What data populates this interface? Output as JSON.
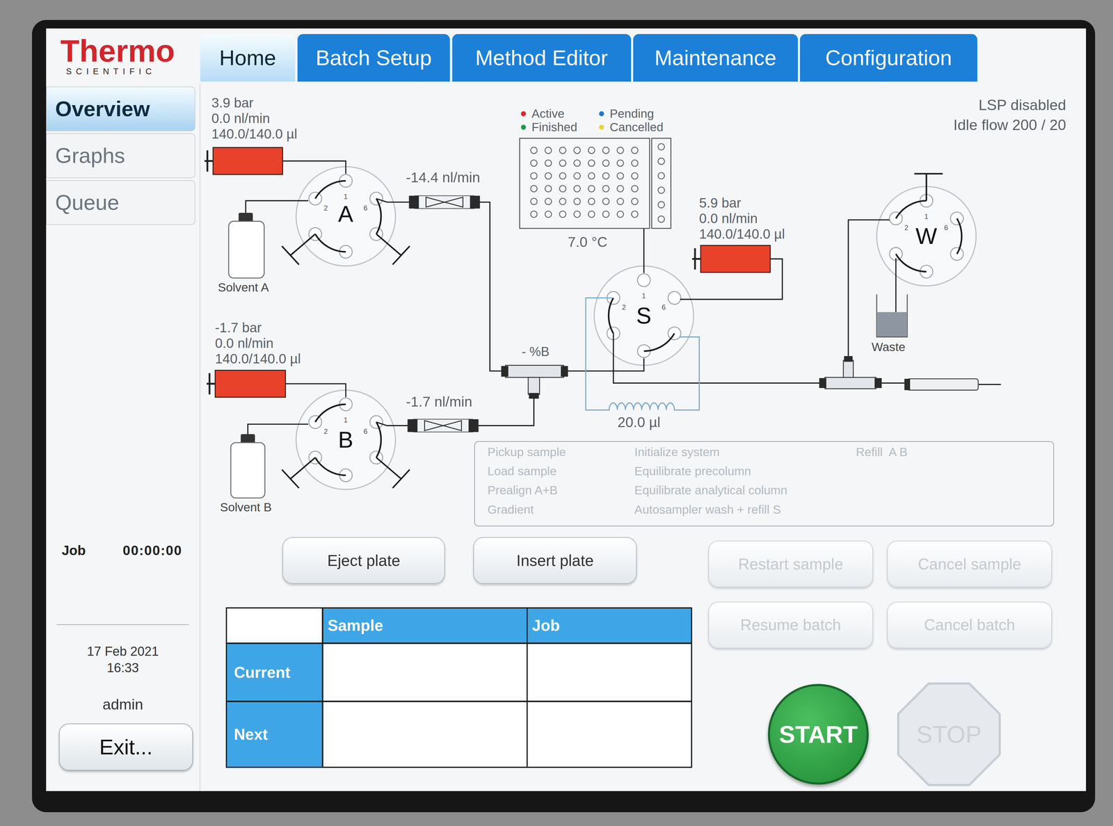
{
  "brand": {
    "name": "Thermo",
    "tagline": "SCIENTIFIC"
  },
  "tabs": [
    {
      "label": "Home",
      "selected": true
    },
    {
      "label": "Batch Setup",
      "selected": false
    },
    {
      "label": "Method Editor",
      "selected": false
    },
    {
      "label": "Maintenance",
      "selected": false
    },
    {
      "label": "Configuration",
      "selected": false
    }
  ],
  "sidebar": {
    "items": [
      {
        "label": "Overview",
        "selected": true
      },
      {
        "label": "Graphs",
        "selected": false
      },
      {
        "label": "Queue",
        "selected": false
      }
    ],
    "job_label": "Job",
    "job_time": "00:00:00",
    "date": "17 Feb 2021",
    "time": "16:33",
    "user": "admin",
    "exit": "Exit..."
  },
  "status": [
    "LSP disabled",
    "Idle flow 200 / 20"
  ],
  "legend": [
    {
      "label": "Active",
      "color": "#e3262b"
    },
    {
      "label": "Pending",
      "color": "#1f76d9"
    },
    {
      "label": "Finished",
      "color": "#1d9a45"
    },
    {
      "label": "Cancelled",
      "color": "#e6d53c"
    }
  ],
  "pumps": [
    {
      "pressure": "3.9 bar",
      "flow": "0.0 nl/min",
      "volume": "140.0/140.0 µl",
      "level": 1
    },
    {
      "pressure": "-1.7 bar",
      "flow": "0.0 nl/min",
      "volume": "140.0/140.0 µl",
      "level": 1
    },
    {
      "pressure": "5.9 bar",
      "flow": "0.0 nl/min",
      "volume": "140.0/140.0 µl",
      "level": 1
    }
  ],
  "valves": [
    {
      "label": "A",
      "ports": [
        "1",
        "2",
        "6"
      ]
    },
    {
      "label": "B",
      "ports": [
        "1",
        "2",
        "6"
      ]
    },
    {
      "label": "S",
      "ports": [
        "1",
        "2",
        "6"
      ]
    },
    {
      "label": "W",
      "ports": [
        "1",
        "2",
        "6"
      ]
    }
  ],
  "solvents": [
    "Solvent A",
    "Solvent B"
  ],
  "flow_sensors": [
    "-14.4 nl/min",
    "-1.7 nl/min"
  ],
  "mixer": "- %B",
  "plate_temperature": "7.0 °C",
  "loop_volume": "20.0 µl",
  "waste": "Waste",
  "steps": [
    {
      "items": [
        {
          "label": "Pickup sample",
          "active": false
        },
        {
          "label": "Load sample",
          "active": false
        },
        {
          "label": "Prealign A+B",
          "active": false
        },
        {
          "label": "Gradient",
          "active": false
        }
      ]
    },
    {
      "items": [
        {
          "label": "Initialize system",
          "active": false
        },
        {
          "label": "Equilibrate precolumn",
          "active": false
        },
        {
          "label": "Equilibrate analytical column",
          "active": false
        },
        {
          "label": "Autosampler wash + refill S",
          "active": false
        }
      ]
    },
    {
      "items": [
        {
          "label": "Refill  A B",
          "active": false
        }
      ]
    }
  ],
  "buttons": [
    {
      "label": "Eject plate",
      "disabled": false
    },
    {
      "label": "Insert plate",
      "disabled": false
    },
    {
      "label": "Restart sample",
      "disabled": true
    },
    {
      "label": "Cancel sample",
      "disabled": true
    },
    {
      "label": "Resume batch",
      "disabled": true
    },
    {
      "label": "Cancel batch",
      "disabled": true
    }
  ],
  "table": {
    "columns": [
      "Sample",
      "Job"
    ],
    "rows": [
      {
        "label": "Current",
        "cells": [
          "",
          ""
        ]
      },
      {
        "label": "Next",
        "cells": [
          "",
          ""
        ]
      }
    ]
  },
  "start": {
    "label": "START",
    "disabled": false
  },
  "stop": {
    "label": "STOP",
    "disabled": true
  }
}
